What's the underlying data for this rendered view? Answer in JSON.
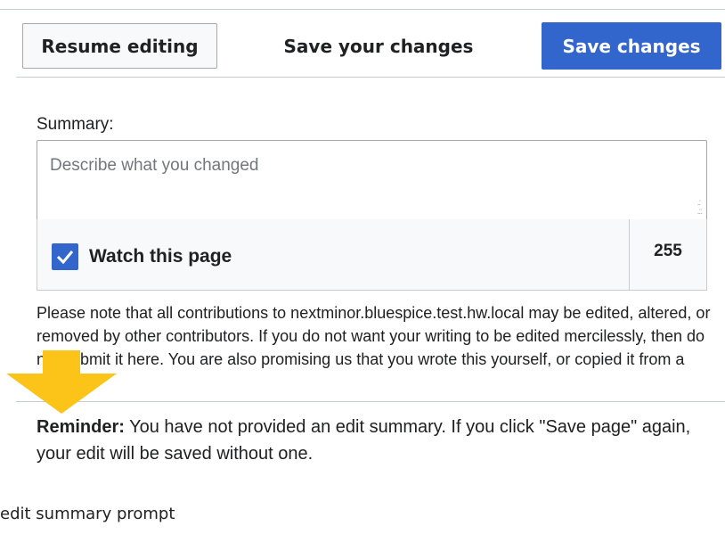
{
  "header": {
    "resume_label": "Resume editing",
    "title": "Save your changes",
    "save_label": "Save changes"
  },
  "summary": {
    "label": "Summary:",
    "placeholder": "Describe what you changed",
    "value": ""
  },
  "options": {
    "watch_label": "Watch this page",
    "watch_checked": true,
    "char_remaining": "255"
  },
  "license": {
    "text": "Please note that all contributions to nextminor.bluespice.test.hw.local may be edited, altered, or removed by other contributors. If you do not want your writing to be edited mercilessly, then do not submit it here. You are also promising us that you wrote this yourself, or copied it from a public"
  },
  "reminder": {
    "label": "Reminder:",
    "text": " You have not provided an edit summary. If you click \"Save page\" again, your edit will be saved without one."
  },
  "caption": "edit summary prompt",
  "colors": {
    "accent": "#3366cc",
    "arrow": "#fcc419"
  },
  "icons": [
    "checkmark-icon",
    "resize-grip-icon",
    "down-arrow-icon"
  ]
}
